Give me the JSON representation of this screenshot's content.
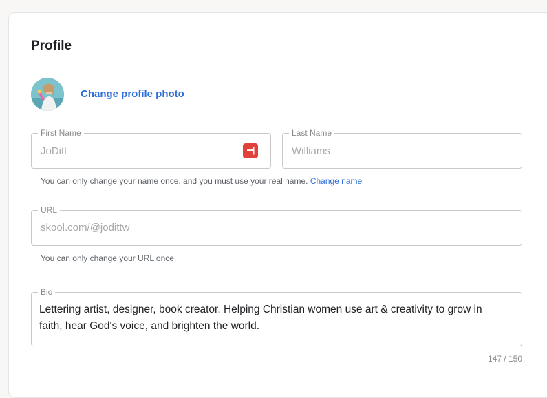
{
  "profile": {
    "title": "Profile",
    "change_photo_label": "Change profile photo"
  },
  "first_name": {
    "legend": "First Name",
    "value": "JoDitt",
    "icon": "password-manager-icon"
  },
  "last_name": {
    "legend": "Last Name",
    "value": "Williams"
  },
  "name_helper": {
    "text": "You can only change your name once, and you must use your real name.",
    "link_label": "Change name"
  },
  "url": {
    "legend": "URL",
    "value": "skool.com/@jodittw",
    "helper": "You can only change your URL once."
  },
  "bio": {
    "legend": "Bio",
    "value": " Lettering artist, designer, book creator. Helping Christian women use art & creativity to grow in faith, hear God's voice, and brighten the world.",
    "counter": "147 / 150"
  },
  "colors": {
    "accent": "#2f6fdb",
    "icon_red": "#e0413a"
  }
}
